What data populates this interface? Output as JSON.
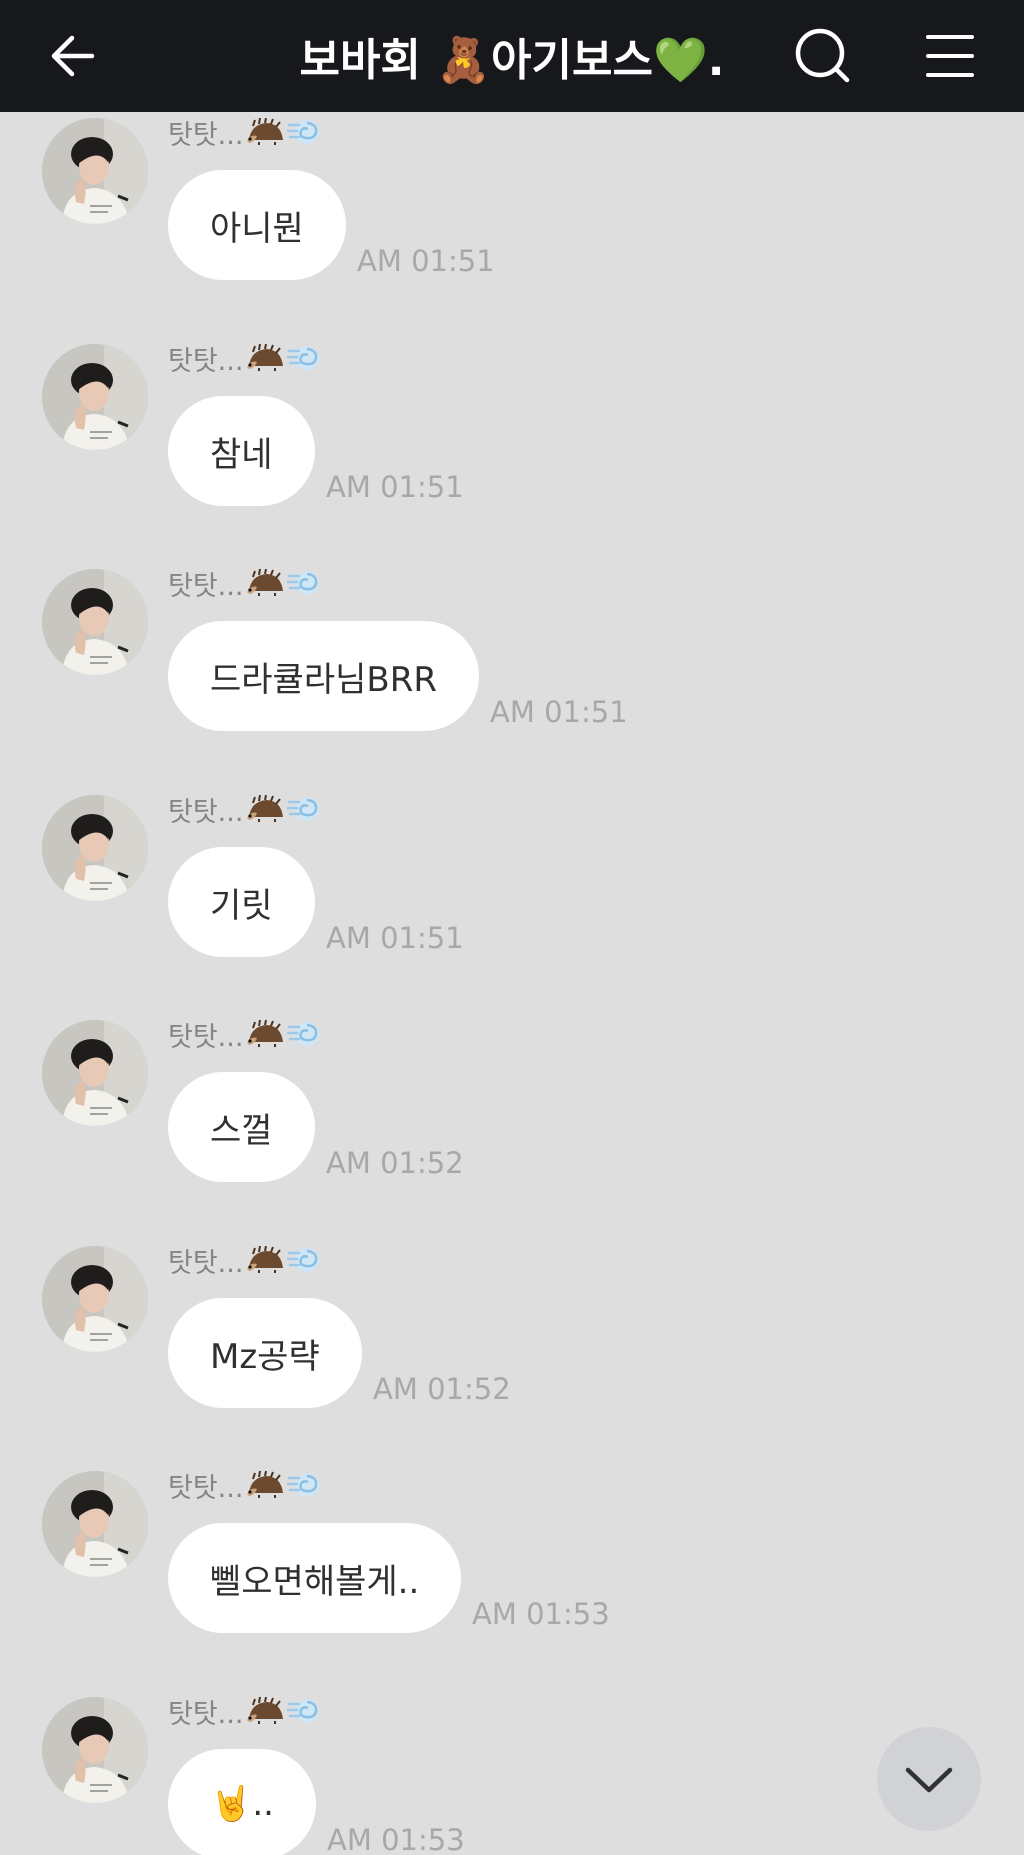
{
  "header": {
    "title": "보바회 🧸아기보스💚."
  },
  "messages": [
    {
      "sender": "탓탓...",
      "text": "아니뭔",
      "time": "AM 01:51"
    },
    {
      "sender": "탓탓...",
      "text": "참네",
      "time": "AM 01:51"
    },
    {
      "sender": "탓탓...",
      "text": "드라큘라님BRR",
      "time": "AM 01:51"
    },
    {
      "sender": "탓탓...",
      "text": "기릿",
      "time": "AM 01:51"
    },
    {
      "sender": "탓탓...",
      "text": "스껄",
      "time": "AM 01:52"
    },
    {
      "sender": "탓탓...",
      "text": "Mz공략",
      "time": "AM 01:52"
    },
    {
      "sender": "탓탓...",
      "text": "뻴오면해볼게..",
      "time": "AM 01:53"
    },
    {
      "sender": "탓탓...",
      "text": "🤘..",
      "time": "AM 01:53"
    }
  ],
  "icons": {
    "back": "arrow-left-icon",
    "search": "search-icon",
    "menu": "hamburger-menu-icon",
    "sender_emoji_1": "hedgehog-icon",
    "sender_emoji_2": "dash-icon",
    "scroll_down": "chevron-down-icon"
  },
  "colors": {
    "header_bg": "#17181c",
    "chat_bg": "#dedede",
    "bubble": "#ffffff",
    "time": "#a8a8a8",
    "sender": "#858585"
  }
}
